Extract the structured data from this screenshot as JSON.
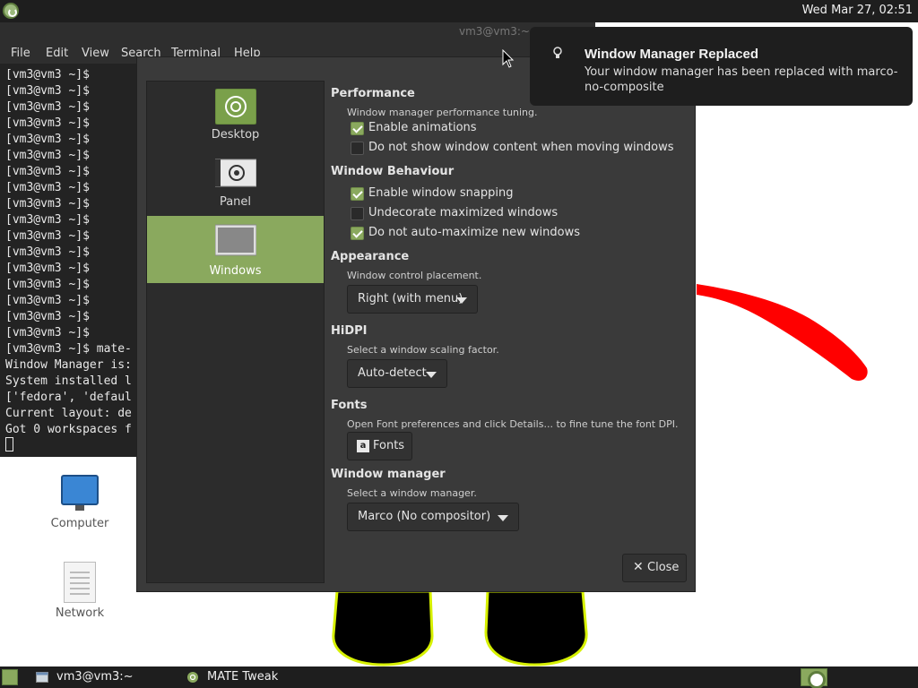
{
  "top_panel": {
    "clock": "Wed Mar 27, 02:51",
    "menu_icon": "mate-logo-icon"
  },
  "terminal": {
    "title": "vm3@vm3:~",
    "menu": [
      "File",
      "Edit",
      "View",
      "Search",
      "Terminal",
      "Help"
    ],
    "lines": [
      "[vm3@vm3 ~]$",
      "[vm3@vm3 ~]$",
      "[vm3@vm3 ~]$",
      "[vm3@vm3 ~]$",
      "[vm3@vm3 ~]$",
      "[vm3@vm3 ~]$",
      "[vm3@vm3 ~]$",
      "[vm3@vm3 ~]$",
      "[vm3@vm3 ~]$",
      "[vm3@vm3 ~]$",
      "[vm3@vm3 ~]$",
      "[vm3@vm3 ~]$",
      "[vm3@vm3 ~]$",
      "[vm3@vm3 ~]$",
      "[vm3@vm3 ~]$",
      "[vm3@vm3 ~]$",
      "[vm3@vm3 ~]$",
      "[vm3@vm3 ~]$ mate-",
      "Window Manager is:",
      "System installed l",
      "['fedora', 'defaul",
      "Current layout: de",
      "Got 0 workspaces f"
    ]
  },
  "desktop": {
    "icons": [
      {
        "label": "Computer",
        "icon": "computer-icon"
      },
      {
        "label": "Network",
        "icon": "network-icon"
      }
    ]
  },
  "notification": {
    "title": "Window Manager Replaced",
    "body": "Your window manager has been replaced with marco-no-composite",
    "icon": "lightbulb-icon"
  },
  "tweak": {
    "sidebar": [
      {
        "label": "Desktop",
        "icon": "desktop-icon",
        "active": false
      },
      {
        "label": "Panel",
        "icon": "panel-icon",
        "active": false
      },
      {
        "label": "Windows",
        "icon": "windows-icon",
        "active": true
      }
    ],
    "performance": {
      "title": "Performance",
      "desc": "Window manager performance tuning.",
      "options": [
        {
          "label": "Enable animations",
          "checked": true
        },
        {
          "label": "Do not show window content when moving windows",
          "checked": false
        }
      ]
    },
    "behaviour": {
      "title": "Window Behaviour",
      "options": [
        {
          "label": "Enable window snapping",
          "checked": true
        },
        {
          "label": "Undecorate maximized windows",
          "checked": false
        },
        {
          "label": "Do not auto-maximize new windows",
          "checked": true
        }
      ]
    },
    "appearance": {
      "title": "Appearance",
      "desc": "Window control placement.",
      "value": "Right (with menu)"
    },
    "hidpi": {
      "title": "HiDPI",
      "desc": "Select a window scaling factor.",
      "value": "Auto-detect"
    },
    "fonts": {
      "title": "Fonts",
      "desc": "Open Font preferences and click Details... to fine tune the font DPI.",
      "button": "Fonts"
    },
    "wm": {
      "title": "Window manager",
      "desc": "Select a window manager.",
      "value": "Marco (No compositor)"
    },
    "close_label": "Close"
  },
  "taskbar": {
    "items": [
      {
        "label": "vm3@vm3:~",
        "icon": "terminal-icon"
      },
      {
        "label": "MATE Tweak",
        "icon": "mate-tweak-icon"
      }
    ]
  },
  "colors": {
    "accent": "#8aa95e",
    "dialog_bg": "#3a3a3a",
    "panel_bg": "#1e1e1e",
    "terminal_bg": "#232323"
  }
}
